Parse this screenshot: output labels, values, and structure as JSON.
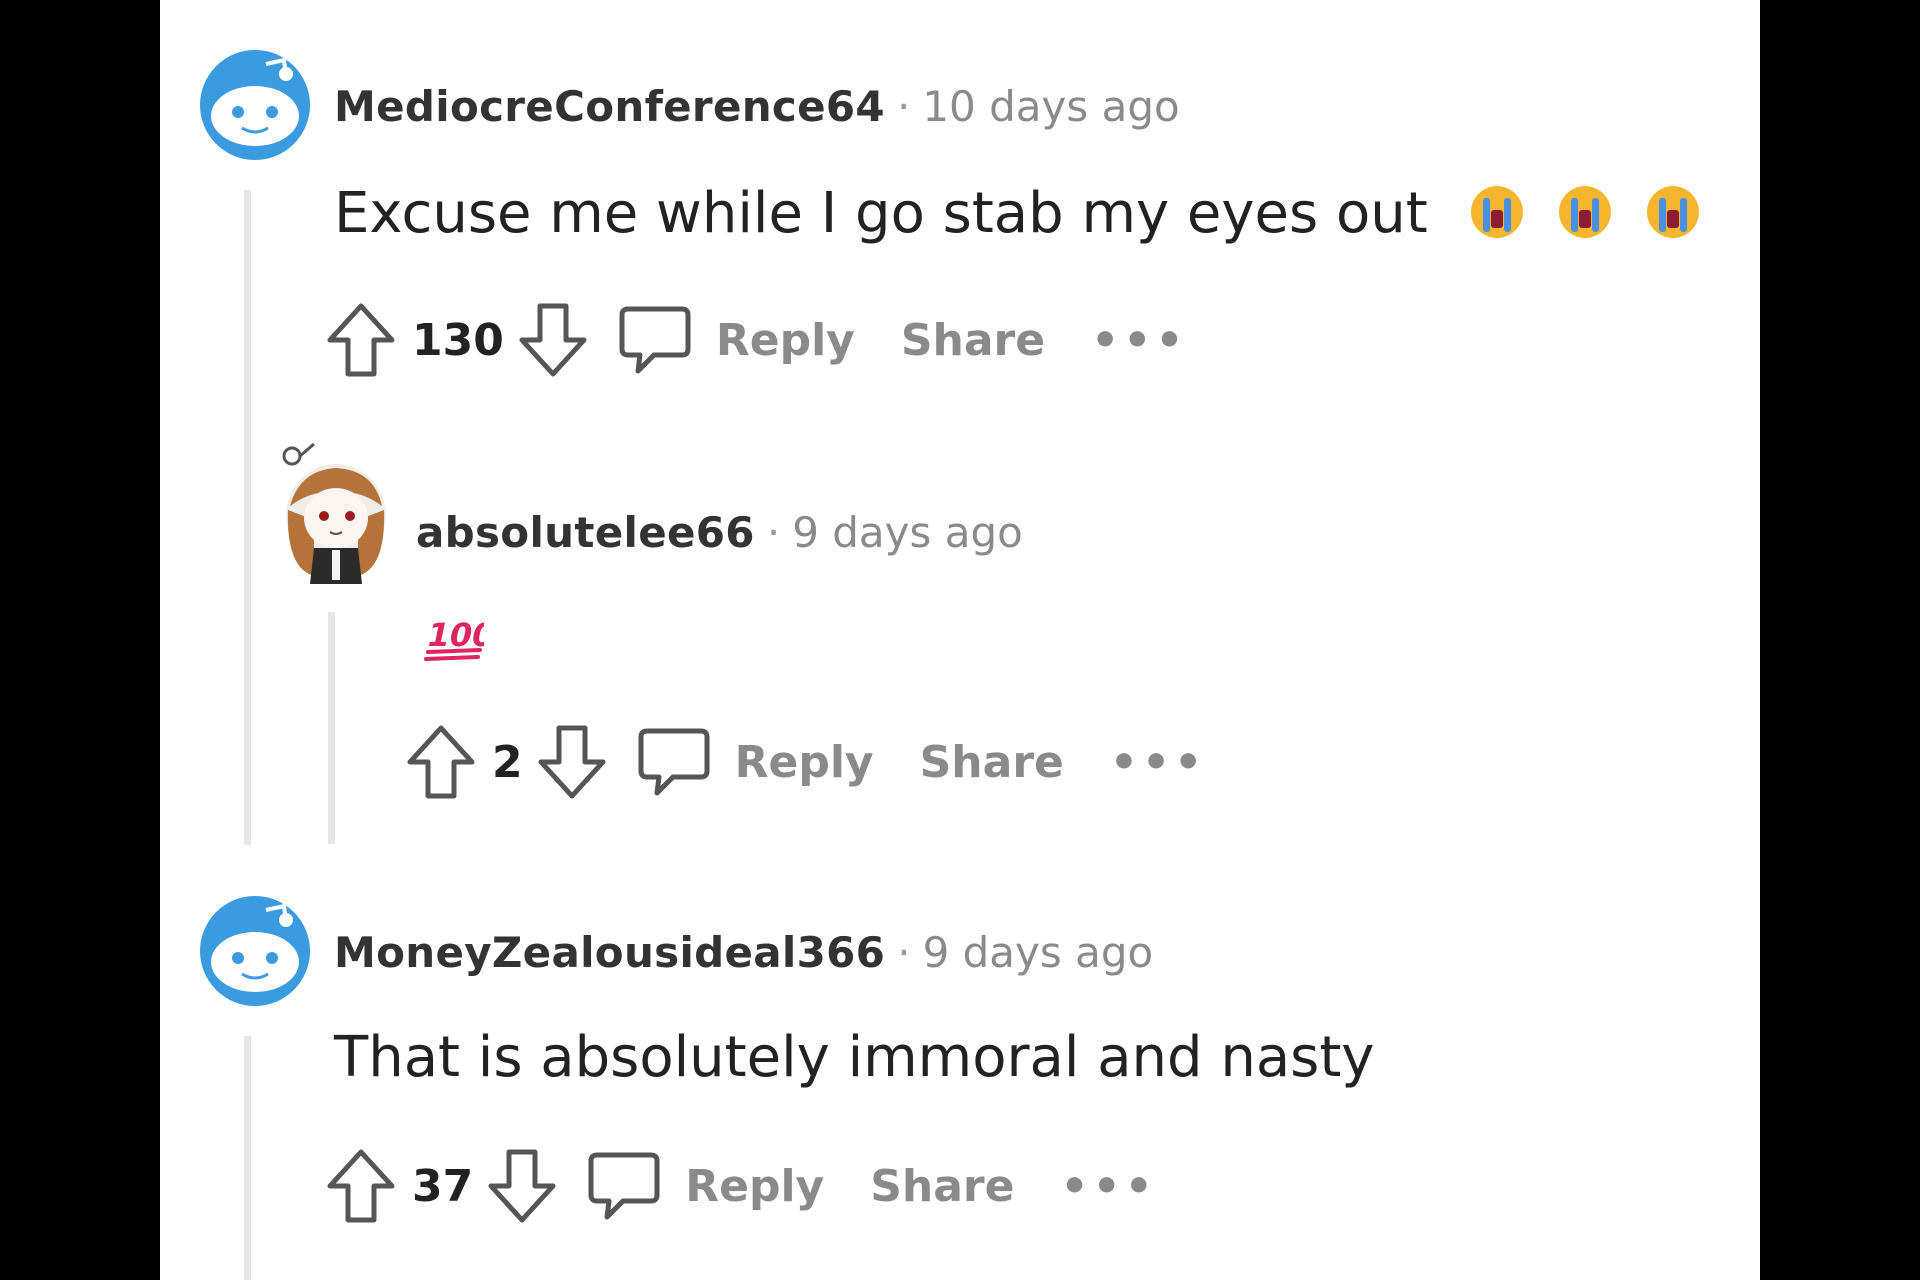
{
  "comments": [
    {
      "username": "MediocreConference64",
      "separator": "·",
      "time": "10 days ago",
      "text": "Excuse me while I go stab my eyes out",
      "emoji_count": 3,
      "score": "130",
      "reply_label": "Reply",
      "share_label": "Share",
      "more_label": "•••"
    },
    {
      "username": "absolutelee66",
      "separator": "·",
      "time": "9 days ago",
      "emoji": "💯",
      "score": "2",
      "reply_label": "Reply",
      "share_label": "Share",
      "more_label": "•••"
    },
    {
      "username": "MoneyZealousideal366",
      "separator": "·",
      "time": "9 days ago",
      "text": "That is absolutely immoral and nasty",
      "score": "37",
      "reply_label": "Reply",
      "share_label": "Share",
      "more_label": "•••"
    }
  ],
  "icons": {
    "avatar_default": "snoo-avatar-icon",
    "avatar_custom": "girl-avatar-icon",
    "upvote": "upvote-arrow-icon",
    "downvote": "downvote-arrow-icon",
    "reply": "comment-bubble-icon",
    "emoji_crying": "loudly-crying-face-icon",
    "emoji_hundred": "hundred-points-icon"
  },
  "colors": {
    "background": "#000000",
    "panel": "#ffffff",
    "snoo_blue": "#3a9be0",
    "username": "#333333",
    "muted": "#8a8a8a",
    "body_text": "#222222",
    "thread_line": "#e6e6e6",
    "hundred_red": "#e0245e"
  }
}
